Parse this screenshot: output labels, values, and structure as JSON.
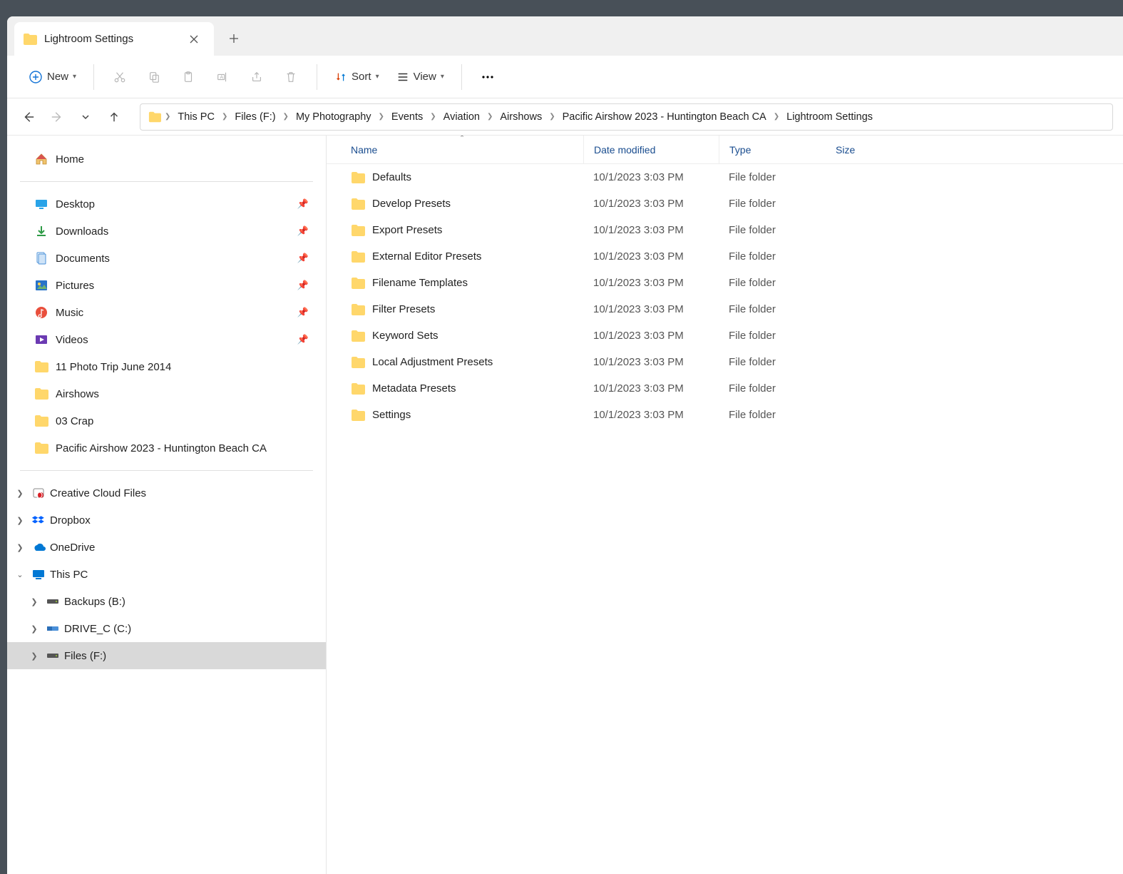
{
  "tab": {
    "title": "Lightroom Settings"
  },
  "toolbar": {
    "new": "New",
    "sort": "Sort",
    "view": "View"
  },
  "breadcrumb": [
    "This PC",
    "Files (F:)",
    "My Photography",
    "Events",
    "Aviation",
    "Airshows",
    "Pacific Airshow 2023 - Huntington Beach CA",
    "Lightroom Settings"
  ],
  "sidebar": {
    "home": "Home",
    "quick": [
      {
        "label": "Desktop",
        "icon": "desktop",
        "pin": true
      },
      {
        "label": "Downloads",
        "icon": "downloads",
        "pin": true
      },
      {
        "label": "Documents",
        "icon": "documents",
        "pin": true
      },
      {
        "label": "Pictures",
        "icon": "pictures",
        "pin": true
      },
      {
        "label": "Music",
        "icon": "music",
        "pin": true
      },
      {
        "label": "Videos",
        "icon": "videos",
        "pin": true
      },
      {
        "label": "11 Photo Trip June 2014",
        "icon": "folder",
        "pin": false
      },
      {
        "label": "Airshows",
        "icon": "folder",
        "pin": false
      },
      {
        "label": "03 Crap",
        "icon": "folder",
        "pin": false
      },
      {
        "label": "Pacific Airshow 2023 - Huntington Beach CA",
        "icon": "folder",
        "pin": false
      }
    ],
    "cloud": [
      {
        "label": "Creative Cloud Files",
        "icon": "ccloud"
      },
      {
        "label": "Dropbox",
        "icon": "dropbox"
      },
      {
        "label": "OneDrive",
        "icon": "onedrive"
      }
    ],
    "thispc": {
      "label": "This PC",
      "icon": "pc",
      "expanded": true
    },
    "drives": [
      {
        "label": "Backups (B:)",
        "selected": false
      },
      {
        "label": "DRIVE_C (C:)",
        "selected": false
      },
      {
        "label": "Files (F:)",
        "selected": true
      }
    ]
  },
  "columns": {
    "name": "Name",
    "date": "Date modified",
    "type": "Type",
    "size": "Size"
  },
  "rows": [
    {
      "name": "Defaults",
      "date": "10/1/2023 3:03 PM",
      "type": "File folder",
      "size": ""
    },
    {
      "name": "Develop Presets",
      "date": "10/1/2023 3:03 PM",
      "type": "File folder",
      "size": ""
    },
    {
      "name": "Export Presets",
      "date": "10/1/2023 3:03 PM",
      "type": "File folder",
      "size": ""
    },
    {
      "name": "External Editor Presets",
      "date": "10/1/2023 3:03 PM",
      "type": "File folder",
      "size": ""
    },
    {
      "name": "Filename Templates",
      "date": "10/1/2023 3:03 PM",
      "type": "File folder",
      "size": ""
    },
    {
      "name": "Filter Presets",
      "date": "10/1/2023 3:03 PM",
      "type": "File folder",
      "size": ""
    },
    {
      "name": "Keyword Sets",
      "date": "10/1/2023 3:03 PM",
      "type": "File folder",
      "size": ""
    },
    {
      "name": "Local Adjustment Presets",
      "date": "10/1/2023 3:03 PM",
      "type": "File folder",
      "size": ""
    },
    {
      "name": "Metadata Presets",
      "date": "10/1/2023 3:03 PM",
      "type": "File folder",
      "size": ""
    },
    {
      "name": "Settings",
      "date": "10/1/2023 3:03 PM",
      "type": "File folder",
      "size": ""
    }
  ]
}
